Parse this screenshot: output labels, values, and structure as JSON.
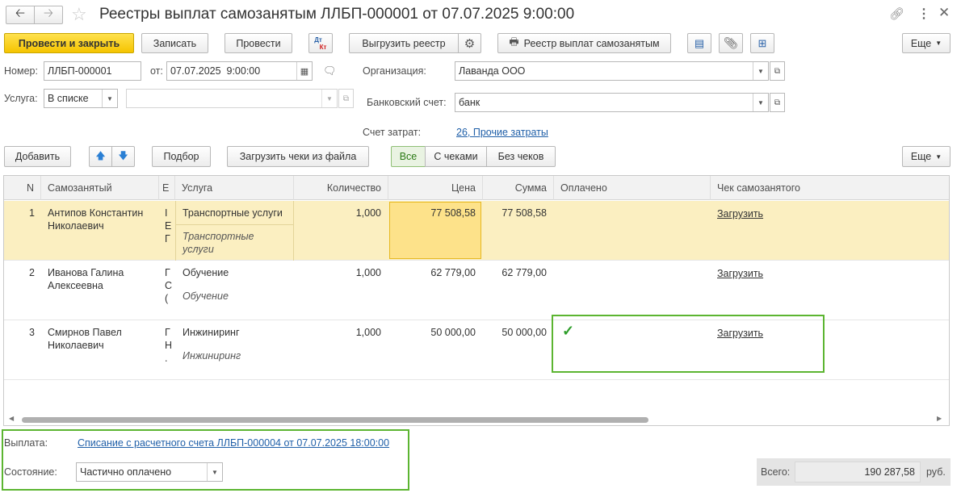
{
  "window": {
    "title": "Реестры выплат самозанятым ЛЛБП-000001 от 07.07.2025 9:00:00"
  },
  "toolbar": {
    "post_close": "Провести и закрыть",
    "save": "Записать",
    "post": "Провести",
    "dtkt_dt": "Дт",
    "dtkt_kt": "Кт",
    "export": "Выгрузить реестр",
    "print_registry": "Реестр выплат самозанятым",
    "more": "Еще"
  },
  "header": {
    "number_label": "Номер:",
    "number_value": "ЛЛБП-000001",
    "from_label": "от:",
    "date_value": "07.07.2025  9:00:00",
    "org_label": "Организация:",
    "org_value": "Лаванда ООО",
    "service_label": "Услуга:",
    "service_mode": "В списке",
    "bank_label": "Банковский счет:",
    "bank_value": "банк",
    "cost_label": "Счет затрат:",
    "cost_value": "26, Прочие затраты"
  },
  "table_toolbar": {
    "add": "Добавить",
    "pick": "Подбор",
    "load_checks": "Загрузить чеки из файла",
    "filter_all": "Все",
    "filter_with": "С чеками",
    "filter_without": "Без чеков",
    "more": "Еще"
  },
  "table": {
    "columns": {
      "n": "N",
      "person": "Самозанятый",
      "e": "Е",
      "service": "Услуга",
      "qty": "Количество",
      "price": "Цена",
      "sum": "Сумма",
      "paid": "Оплачено",
      "check": "Чек самозанятого"
    },
    "rows": [
      {
        "n": "1",
        "person": [
          "Антипов Константин",
          "Николаевич"
        ],
        "e": [
          "І",
          "Е",
          "Г"
        ],
        "service": "Транспортные услуги",
        "service_desc": [
          "Транспортные",
          "услуги"
        ],
        "qty": "1,000",
        "price": "77 508,58",
        "sum": "77 508,58",
        "paid": "",
        "check": "Загрузить"
      },
      {
        "n": "2",
        "person": [
          "Иванова Галина",
          "Алексеевна"
        ],
        "e": [
          "Г",
          "С",
          "("
        ],
        "service": "Обучение",
        "service_desc": [
          "Обучение"
        ],
        "qty": "1,000",
        "price": "62 779,00",
        "sum": "62 779,00",
        "paid": "",
        "check": "Загрузить"
      },
      {
        "n": "3",
        "person": [
          "Смирнов Павел",
          "Николаевич"
        ],
        "e": [
          "Г",
          "Н",
          "."
        ],
        "service": "Инжиниринг",
        "service_desc": [
          "Инжиниринг"
        ],
        "qty": "1,000",
        "price": "50 000,00",
        "sum": "50 000,00",
        "paid": "✓",
        "check": "Загрузить"
      }
    ]
  },
  "footer": {
    "payment_label": "Выплата:",
    "payment_link": "Списание с расчетного счета ЛЛБП-000004 от 07.07.2025 18:00:00",
    "state_label": "Состояние:",
    "state_value": "Частично оплачено",
    "total_label": "Всего:",
    "total_value": "190 287,58",
    "currency": "руб."
  },
  "colors": {
    "accent_yellow": "#f5c400",
    "selected_row": "#fbefc1",
    "highlight_box": "#5cb531",
    "link_red": "#d02020",
    "link_blue": "#1f5fa8"
  }
}
